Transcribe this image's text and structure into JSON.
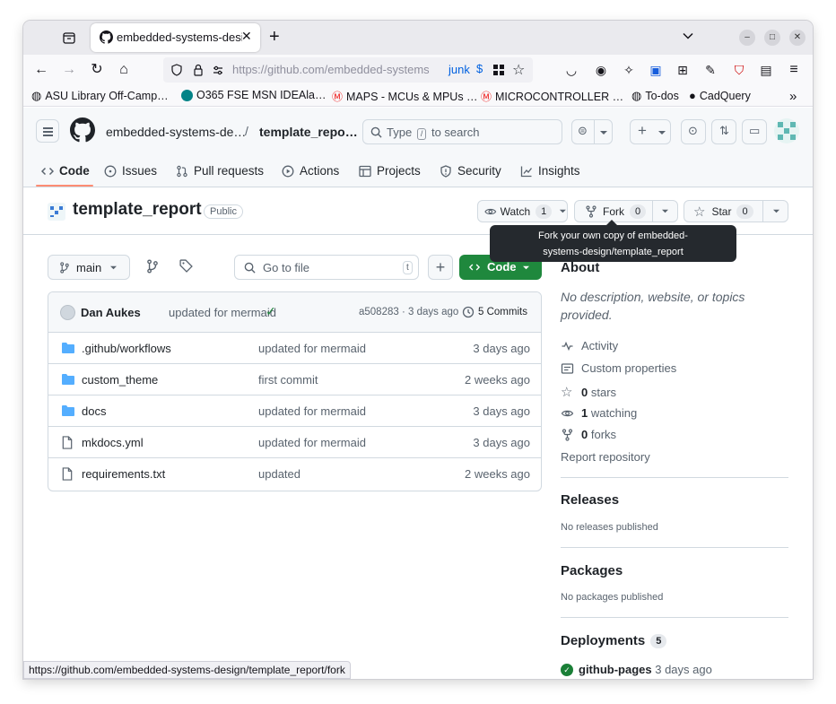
{
  "browser": {
    "tab_title": "embedded-systems-design/template_report",
    "url": "https://github.com/embedded-systems-design/template_report",
    "url_visible": "https://github.com/embedded-systems",
    "url_badge": "junk",
    "bookmarks": [
      {
        "label": "ASU Library Off-Camp…",
        "icon": "globe-icon"
      },
      {
        "label": "O365 FSE MSN IDEAla…",
        "icon": "sharepoint-icon"
      },
      {
        "label": "MAPS - MCUs & MPUs …",
        "icon": "microchip-icon"
      },
      {
        "label": "MICROCONTROLLER …",
        "icon": "microchip-icon"
      },
      {
        "label": "To-dos",
        "icon": "globe-icon"
      },
      {
        "label": "CadQuery",
        "icon": "github-icon"
      }
    ],
    "status_url": "https://github.com/embedded-systems-design/template_report/fork"
  },
  "header": {
    "org": "embedded-systems-de…",
    "separator": "/",
    "repo": "template_repo…",
    "search_prefix": "Type",
    "search_key": "/",
    "search_suffix": "to search"
  },
  "repo_nav": [
    {
      "label": "Code",
      "icon": "code-icon",
      "active": true
    },
    {
      "label": "Issues",
      "icon": "issue-icon"
    },
    {
      "label": "Pull requests",
      "icon": "pull-request-icon"
    },
    {
      "label": "Actions",
      "icon": "play-icon"
    },
    {
      "label": "Projects",
      "icon": "table-icon"
    },
    {
      "label": "Security",
      "icon": "shield-icon"
    },
    {
      "label": "Insights",
      "icon": "graph-icon"
    }
  ],
  "repo": {
    "name": "template_report",
    "visibility": "Public",
    "watch_label": "Watch",
    "watch_count": "1",
    "fork_label": "Fork",
    "fork_count": "0",
    "star_label": "Star",
    "star_count": "0",
    "tooltip_line1": "Fork your own copy of embedded-",
    "tooltip_line2": "systems-design/template_report"
  },
  "toolbar": {
    "branch": "main",
    "goto_placeholder": "Go to file",
    "goto_key": "t",
    "code_label": "Code"
  },
  "commit": {
    "author": "Dan Aukes",
    "message": "updated for mermaid",
    "hash_date": "a508283 · 3 days ago",
    "commits_label": "5 Commits"
  },
  "files": [
    {
      "name": ".github/workflows",
      "type": "folder",
      "message": "updated for mermaid",
      "date": "3 days ago"
    },
    {
      "name": "custom_theme",
      "type": "folder",
      "message": "first commit",
      "date": "2 weeks ago"
    },
    {
      "name": "docs",
      "type": "folder",
      "message": "updated for mermaid",
      "date": "3 days ago"
    },
    {
      "name": "mkdocs.yml",
      "type": "file",
      "message": "updated for mermaid",
      "date": "3 days ago"
    },
    {
      "name": "requirements.txt",
      "type": "file",
      "message": "updated",
      "date": "2 weeks ago"
    }
  ],
  "about": {
    "heading": "About",
    "description": "No description, website, or topics provided.",
    "activity": "Activity",
    "custom_properties": "Custom properties",
    "stars_count": "0",
    "stars_label": "stars",
    "watching_count": "1",
    "watching_label": "watching",
    "forks_count": "0",
    "forks_label": "forks",
    "report": "Report repository"
  },
  "releases": {
    "heading": "Releases",
    "empty": "No releases published"
  },
  "packages": {
    "heading": "Packages",
    "empty": "No packages published"
  },
  "deployments": {
    "heading": "Deployments",
    "count": "5",
    "env": "github-pages",
    "when": "3 days ago"
  },
  "colors": {
    "accent_green": "#1f883d",
    "link_blue": "#0969da",
    "underline_orange": "#fd8c73"
  }
}
